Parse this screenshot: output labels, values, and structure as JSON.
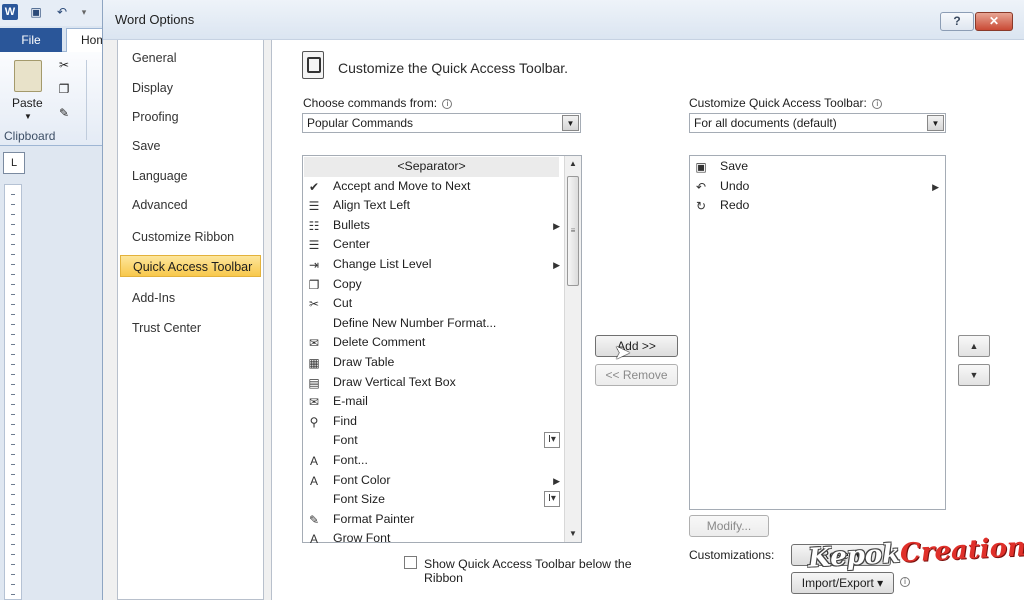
{
  "word": {
    "logo": "W",
    "file_tab": "File",
    "home_tab": "Hom",
    "paste_label": "Paste",
    "clipboard_label": "Clipboard",
    "ruler_corner": "L"
  },
  "dialog": {
    "title": "Word Options",
    "help": "?",
    "close": "✕"
  },
  "nav": {
    "items": [
      {
        "label": "General"
      },
      {
        "label": "Display"
      },
      {
        "label": "Proofing"
      },
      {
        "label": "Save"
      },
      {
        "label": "Language"
      },
      {
        "label": "Advanced"
      },
      {
        "label": "Customize Ribbon"
      },
      {
        "label": "Quick Access Toolbar",
        "selected": true
      },
      {
        "label": "Add-Ins"
      },
      {
        "label": "Trust Center"
      }
    ]
  },
  "content": {
    "title": "Customize the Quick Access Toolbar.",
    "choose_label": "Choose commands from:",
    "choose_value": "Popular Commands",
    "customize_label": "Customize Quick Access Toolbar:",
    "customize_value": "For all documents (default)",
    "info": "i"
  },
  "commands": [
    {
      "label": "<Separator>",
      "icon": "separator",
      "glyph": "",
      "sub": ""
    },
    {
      "label": "Accept and Move to Next",
      "icon": "accept-icon",
      "glyph": "✔",
      "sub": ""
    },
    {
      "label": "Align Text Left",
      "icon": "align-left-icon",
      "glyph": "☰",
      "sub": ""
    },
    {
      "label": "Bullets",
      "icon": "bullets-icon",
      "glyph": "☷",
      "sub": "▶"
    },
    {
      "label": "Center",
      "icon": "center-icon",
      "glyph": "☰",
      "sub": ""
    },
    {
      "label": "Change List Level",
      "icon": "list-level-icon",
      "glyph": "⇥",
      "sub": "▶"
    },
    {
      "label": "Copy",
      "icon": "copy-icon",
      "glyph": "❐",
      "sub": ""
    },
    {
      "label": "Cut",
      "icon": "scissors-icon",
      "glyph": "✂",
      "sub": ""
    },
    {
      "label": "Define New Number Format...",
      "icon": "none",
      "glyph": "",
      "sub": ""
    },
    {
      "label": "Delete Comment",
      "icon": "delete-comment-icon",
      "glyph": "✉",
      "sub": ""
    },
    {
      "label": "Draw Table",
      "icon": "draw-table-icon",
      "glyph": "▦",
      "sub": ""
    },
    {
      "label": "Draw Vertical Text Box",
      "icon": "text-box-icon",
      "glyph": "▤",
      "sub": ""
    },
    {
      "label": "E-mail",
      "icon": "email-icon",
      "glyph": "✉",
      "sub": ""
    },
    {
      "label": "Find",
      "icon": "binoculars-icon",
      "glyph": "⚲",
      "sub": ""
    },
    {
      "label": "Font",
      "icon": "none",
      "glyph": "",
      "sub": "I▾"
    },
    {
      "label": "Font...",
      "icon": "font-icon",
      "glyph": "A",
      "sub": ""
    },
    {
      "label": "Font Color",
      "icon": "font-color-icon",
      "glyph": "A",
      "sub": "▶"
    },
    {
      "label": "Font Size",
      "icon": "none",
      "glyph": "",
      "sub": "I▾"
    },
    {
      "label": "Format Painter",
      "icon": "format-painter-icon",
      "glyph": "✎",
      "sub": ""
    },
    {
      "label": "Grow Font",
      "icon": "grow-font-icon",
      "glyph": "A",
      "sub": ""
    }
  ],
  "toolbar_items": [
    {
      "label": "Save",
      "icon": "save-icon",
      "glyph": "▣",
      "sub": ""
    },
    {
      "label": "Undo",
      "icon": "undo-icon",
      "glyph": "↶",
      "sub": "▶"
    },
    {
      "label": "Redo",
      "icon": "redo-icon",
      "glyph": "↻",
      "sub": ""
    }
  ],
  "buttons": {
    "add": "Add >>",
    "remove": "<< Remove",
    "modify": "Modify...",
    "customizations_label": "Customizations:",
    "reset": "Reset ▾",
    "import_export": "Import/Export ▾",
    "move_up": "▲",
    "move_down": "▼"
  },
  "checkbox": {
    "label": "Show Quick Access Toolbar below the Ribbon",
    "checked": false
  },
  "watermark": {
    "part1": "Kepok",
    "part2": "Creation"
  }
}
